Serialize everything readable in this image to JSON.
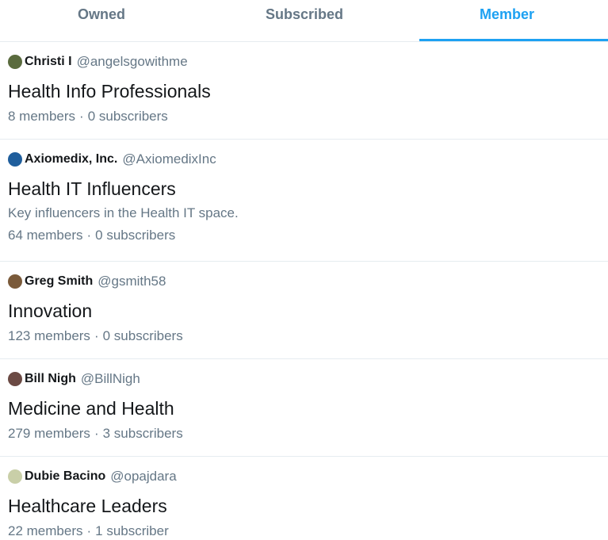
{
  "tabs": [
    {
      "label": "Owned",
      "active": false
    },
    {
      "label": "Subscribed",
      "active": false
    },
    {
      "label": "Member",
      "active": true
    }
  ],
  "accent_color": "#1da1f2",
  "lists": [
    {
      "owner_name": "Christi I",
      "owner_handle": "@angelsgowithme",
      "avatar_icon": "user-avatar",
      "avatar_color": "#5a6b3e",
      "name": "Health Info Professionals",
      "description": "",
      "members": "8 members",
      "subscribers": "0 subscribers"
    },
    {
      "owner_name": "Axiomedix, Inc.",
      "owner_handle": "@AxiomedixInc",
      "avatar_icon": "company-logo",
      "avatar_color": "#1f5e9c",
      "name": "Health IT Influencers",
      "description": "Key influencers in the Health IT space.",
      "members": "64 members",
      "subscribers": "0 subscribers"
    },
    {
      "owner_name": "Greg Smith",
      "owner_handle": "@gsmith58",
      "avatar_icon": "user-avatar",
      "avatar_color": "#7a5a3a",
      "name": "Innovation",
      "description": "",
      "members": "123 members",
      "subscribers": "0 subscribers"
    },
    {
      "owner_name": "Bill Nigh",
      "owner_handle": "@BillNigh",
      "avatar_icon": "user-avatar",
      "avatar_color": "#6b4a44",
      "name": "Medicine and Health",
      "description": "",
      "members": "279 members",
      "subscribers": "3 subscribers"
    },
    {
      "owner_name": "Dubie Bacino",
      "owner_handle": "@opajdara",
      "avatar_icon": "user-avatar",
      "avatar_color": "#c9cfa8",
      "name": "Healthcare Leaders",
      "description": "",
      "members": "22 members",
      "subscribers": "1 subscriber"
    }
  ]
}
